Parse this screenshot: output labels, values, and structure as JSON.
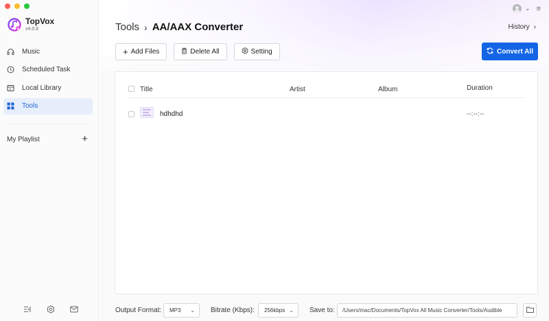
{
  "app": {
    "name": "TopVox",
    "version": "v4.0.8",
    "colors": {
      "accent": "#1465e6",
      "active_bg": "#e7eefb",
      "active_text": "#1e66d6"
    }
  },
  "sidebar": {
    "items": [
      {
        "label": "Music",
        "icon": "headphones-icon",
        "active": false
      },
      {
        "label": "Scheduled Task",
        "icon": "clock-icon",
        "active": false
      },
      {
        "label": "Local Library",
        "icon": "library-icon",
        "active": false
      },
      {
        "label": "Tools",
        "icon": "grid-icon",
        "active": true
      }
    ],
    "playlist_label": "My Playlist",
    "add_playlist_icon": "+"
  },
  "header": {
    "breadcrumb_root": "Tools",
    "breadcrumb_sep": "›",
    "breadcrumb_current": "AA/AAX Converter",
    "history_label": "History",
    "history_chevron": "›"
  },
  "toolbar": {
    "add_files_icon": "+",
    "add_files_label": "Add Files",
    "delete_all_label": "Delete All",
    "setting_label": "Setting",
    "convert_all_label": "Convert All"
  },
  "table": {
    "columns": {
      "title": "Title",
      "artist": "Artist",
      "album": "Album",
      "duration": "Duration"
    },
    "rows": [
      {
        "title": "hdhdhd",
        "artist": "",
        "album": "",
        "duration": "--:--:--"
      }
    ]
  },
  "footer": {
    "output_format_label": "Output Format:",
    "output_format_value": "MP3",
    "bitrate_label": "Bitrate (Kbps):",
    "bitrate_value": "256kbps",
    "save_to_label": "Save to:",
    "save_to_path": "/Users/mac/Documents/TopVox All Music Converter/Tools/Audible"
  }
}
